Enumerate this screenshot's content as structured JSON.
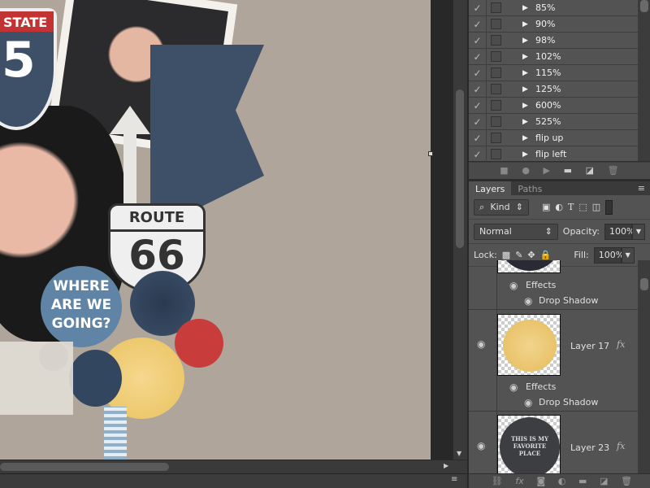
{
  "artwork": {
    "interstate_text": "STATE",
    "interstate_number": "5",
    "route_text": "ROUTE",
    "route_number": "66",
    "badge_lines": [
      "WHERE",
      "ARE WE",
      "GOING?"
    ]
  },
  "actions": {
    "items": [
      {
        "label": "85%",
        "checked": true
      },
      {
        "label": "90%",
        "checked": true
      },
      {
        "label": "98%",
        "checked": true
      },
      {
        "label": "102%",
        "checked": true
      },
      {
        "label": "115%",
        "checked": true
      },
      {
        "label": "125%",
        "checked": true
      },
      {
        "label": "600%",
        "checked": true
      },
      {
        "label": "525%",
        "checked": true
      },
      {
        "label": "flip up",
        "checked": true
      },
      {
        "label": "flip left",
        "checked": true
      }
    ],
    "buttons": [
      "stop-icon",
      "record-icon",
      "play-icon",
      "folder-icon",
      "new-action-icon",
      "trash-icon"
    ]
  },
  "layers": {
    "tabs": [
      "Layers",
      "Paths"
    ],
    "filter": "Kind",
    "blend_mode": "Normal",
    "opacity_label": "Opacity:",
    "opacity": "100%",
    "lock_label": "Lock:",
    "fill_label": "Fill:",
    "fill": "100%",
    "items": [
      {
        "name": "",
        "effects": "Effects",
        "effect": "Drop Shadow"
      },
      {
        "name": "Layer 17",
        "fx": "fx",
        "effects": "Effects",
        "effect": "Drop Shadow"
      },
      {
        "name": "Layer 23",
        "fx": "fx",
        "thumb_text": "THIS IS MY FAVORITE PLACE"
      }
    ]
  },
  "colors": {
    "paper": "#b0a59b",
    "panel": "#535353",
    "navy": "#3d5068"
  }
}
